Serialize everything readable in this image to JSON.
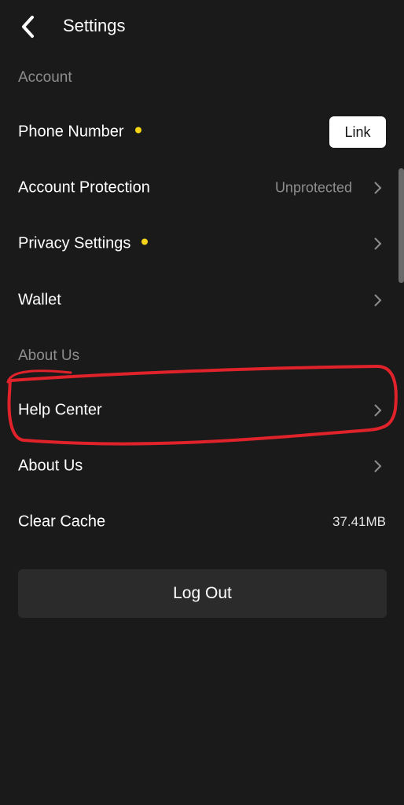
{
  "header": {
    "title": "Settings",
    "back_icon": "chevron-left-icon"
  },
  "sections": {
    "account_label": "Account",
    "about_label": "About Us"
  },
  "rows": {
    "phone_number": {
      "label": "Phone Number",
      "has_dot": true,
      "button_label": "Link"
    },
    "account_protection": {
      "label": "Account Protection",
      "value": "Unprotected"
    },
    "privacy_settings": {
      "label": "Privacy Settings",
      "has_dot": true
    },
    "wallet": {
      "label": "Wallet"
    },
    "help_center": {
      "label": "Help Center"
    },
    "about_us": {
      "label": "About Us"
    },
    "clear_cache": {
      "label": "Clear Cache",
      "value": "37.41MB"
    }
  },
  "logout": {
    "label": "Log Out"
  },
  "colors": {
    "background": "#1a1a1a",
    "dot": "#f5d417",
    "muted_text": "#8e8e8e",
    "annotation": "#e0222a"
  }
}
